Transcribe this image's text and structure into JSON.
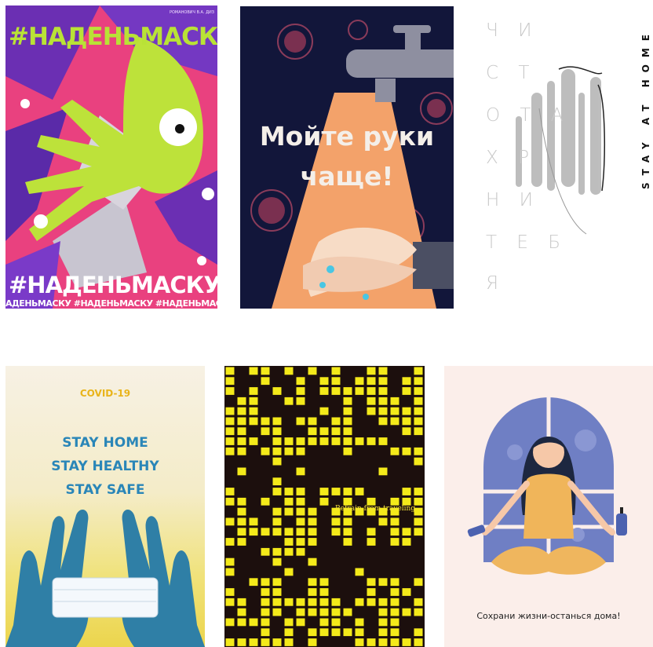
{
  "posters": [
    {
      "tag_top": "#НАДЕНЬМАСКУ",
      "author": "РОМАНОВИЧ В.А. ДИЗ",
      "tag_bottom": "#НАДЕНЬМАСКУ",
      "tag_strip": "АДЕНЬМАСКУ #НАДЕНЬМАСКУ #НАДЕНЬМАСКУ #НАД"
    },
    {
      "headline_line1": "Мойте руки",
      "headline_line2": "чаще!"
    },
    {
      "ru_lines": [
        "Ч И",
        "С Т",
        "О Т А",
        "Х Р",
        "Н И",
        "Т Е Б",
        "Я"
      ],
      "vertical_text": "STAY AT HOME"
    },
    {
      "label": "COVID-19",
      "lines": [
        "STAY HOME",
        "STAY HEALTHY",
        "STAY SAFE"
      ]
    },
    {
      "note": "Refrain from traveling"
    },
    {
      "caption": "Сохрани жизни-останься дома!"
    }
  ]
}
